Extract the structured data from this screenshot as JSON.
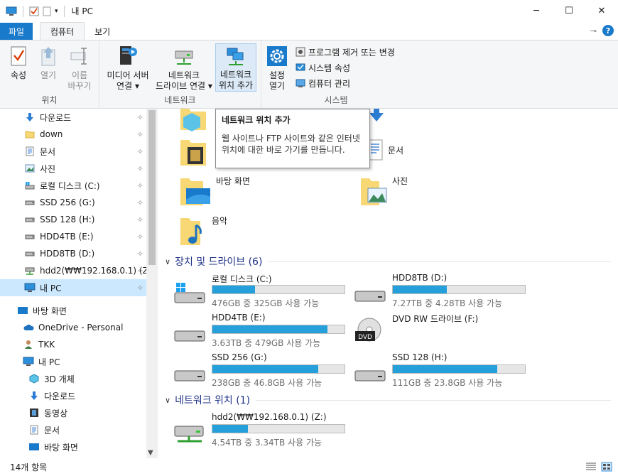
{
  "window": {
    "title": "내 PC",
    "minimize": "─",
    "maximize": "☐",
    "close": "✕"
  },
  "tabs": [
    {
      "label": "파일"
    },
    {
      "label": "컴퓨터"
    },
    {
      "label": "보기"
    }
  ],
  "ribbon": {
    "location": {
      "label": "위치",
      "properties": "속성",
      "open": "열기",
      "rename_1": "이름",
      "rename_2": "바꾸기"
    },
    "network": {
      "label": "네트워크",
      "media_server_1": "미디어 서버",
      "media_server_2": "연결",
      "map_drive_1": "네트워크",
      "map_drive_2": "드라이브 연결",
      "add_location_1": "네트워크",
      "add_location_2": "위치 추가"
    },
    "system": {
      "label": "시스템",
      "settings_1": "설정",
      "settings_2": "열기",
      "uninstall": "프로그램 제거 또는 변경",
      "sys_props": "시스템 속성",
      "manage": "컴퓨터 관리"
    }
  },
  "tooltip": {
    "title": "네트워크 위치 추가",
    "body": "웹 사이트나 FTP 사이트와 같은 인터넷 위치에 대한 바로 가기를 만듭니다."
  },
  "nav": {
    "items": [
      {
        "label": "다운로드",
        "pinned": true
      },
      {
        "label": "down",
        "pinned": true
      },
      {
        "label": "문서",
        "pinned": true
      },
      {
        "label": "사진",
        "pinned": true
      },
      {
        "label": "로컬 디스크 (C:)",
        "pinned": true
      },
      {
        "label": "SSD 256 (G:)",
        "pinned": true
      },
      {
        "label": "SSD 128 (H:)",
        "pinned": true
      },
      {
        "label": "HDD4TB (E:)",
        "pinned": true
      },
      {
        "label": "HDD8TB (D:)",
        "pinned": true
      },
      {
        "label": "hdd2(₩₩192.168.0.1) (Z:",
        "pinned": true
      },
      {
        "label": "내 PC",
        "pinned": true
      },
      {
        "label": "바탕 화면"
      },
      {
        "label": "OneDrive - Personal"
      },
      {
        "label": "TKK"
      },
      {
        "label": "내 PC"
      },
      {
        "label": "3D 개체"
      },
      {
        "label": "다운로드"
      },
      {
        "label": "동영상"
      },
      {
        "label": "문서"
      },
      {
        "label": "바탕 화면"
      }
    ],
    "pin_glyph": "📌"
  },
  "folders": [
    {
      "label": "바탕 화면"
    },
    {
      "label": "사진"
    },
    {
      "label": "음악"
    },
    {
      "label": "문서"
    }
  ],
  "sections": {
    "devices": "장치 및 드라이브 (6)",
    "network": "네트워크 위치 (1)"
  },
  "drives": [
    {
      "name": "로컬 디스크 (C:)",
      "free": "476GB 중 325GB 사용 가능",
      "used_fraction": 0.32
    },
    {
      "name": "HDD8TB (D:)",
      "free": "7.27TB 중 4.28TB 사용 가능",
      "used_fraction": 0.41
    },
    {
      "name": "HDD4TB (E:)",
      "free": "3.63TB 중 479GB 사용 가능",
      "used_fraction": 0.87
    },
    {
      "name": "DVD RW 드라이브 (F:)",
      "free": ""
    },
    {
      "name": "SSD 256 (G:)",
      "free": "238GB 중 46.8GB 사용 가능",
      "used_fraction": 0.8
    },
    {
      "name": "SSD 128 (H:)",
      "free": "111GB 중 23.8GB 사용 가능",
      "used_fraction": 0.79
    },
    {
      "name": "hdd2(₩₩192.168.0.1) (Z:)",
      "free": "4.54TB 중 3.34TB 사용 가능",
      "used_fraction": 0.27
    }
  ],
  "dvd_label": "DVD",
  "status": {
    "count": "14개 항목"
  },
  "colors": {
    "accent": "#1979ca",
    "bar_fill": "#26a0da",
    "selected": "#cce8ff"
  }
}
